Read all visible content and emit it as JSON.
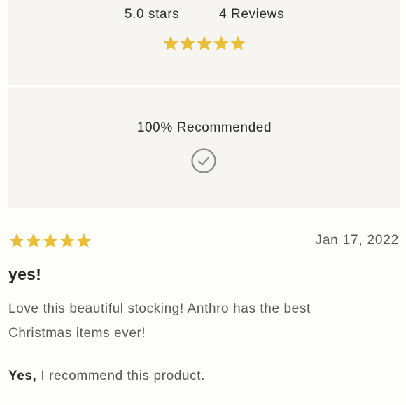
{
  "summary": {
    "rating_text": "5.0 stars",
    "reviews_text": "4 Reviews",
    "star_rating": 5,
    "star_max": 5
  },
  "recommend": {
    "text": "100% Recommended",
    "icon": "checkmark-circle-icon"
  },
  "review": {
    "star_rating": 5,
    "star_max": 5,
    "date": "Jan 17, 2022",
    "title": "yes!",
    "body": "Love this beautiful stocking! Anthro has the best Christmas items ever!",
    "recommend_yes": "Yes,",
    "recommend_rest": " I recommend this product."
  },
  "colors": {
    "star": "#e9bf3a",
    "panel_bg": "#f6f5f2",
    "page_bg": "#fdfdf9"
  }
}
